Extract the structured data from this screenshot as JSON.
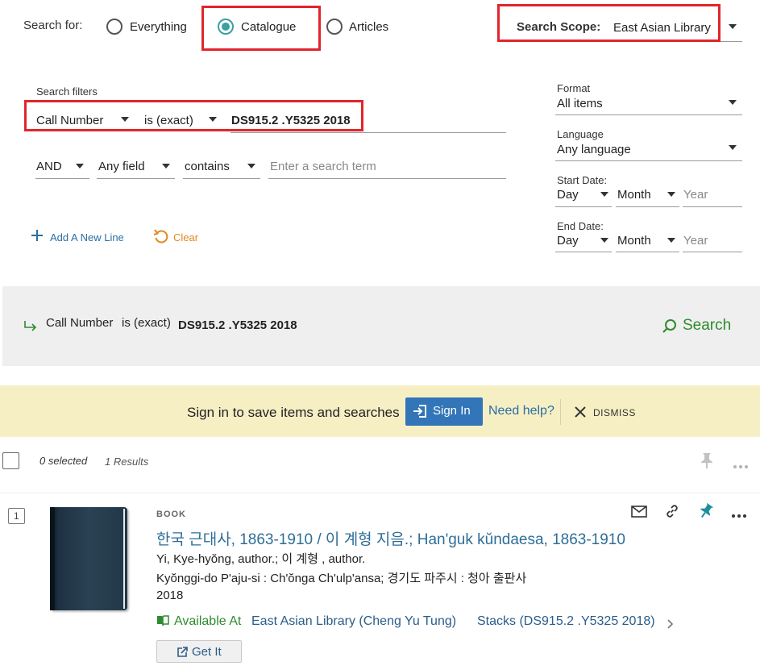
{
  "search_for": {
    "label": "Search for:",
    "options": [
      "Everything",
      "Catalogue",
      "Articles"
    ],
    "selected": "Catalogue"
  },
  "search_scope": {
    "label": "Search Scope:",
    "value": "East Asian Library"
  },
  "filters": {
    "title": "Search filters",
    "row1": {
      "field": "Call Number",
      "operator": "is (exact)",
      "value": "DS915.2 .Y5325 2018"
    },
    "row2": {
      "bool": "AND",
      "field": "Any field",
      "operator": "contains",
      "placeholder": "Enter a search term"
    },
    "add_line": "Add A New Line",
    "clear": "Clear"
  },
  "side_filters": {
    "format": {
      "label": "Format",
      "value": "All items"
    },
    "language": {
      "label": "Language",
      "value": "Any language"
    },
    "start_date": {
      "label": "Start Date:",
      "day": "Day",
      "month": "Month",
      "year_placeholder": "Year"
    },
    "end_date": {
      "label": "End Date:",
      "day": "Day",
      "month": "Month",
      "year_placeholder": "Year"
    }
  },
  "summary": {
    "field": "Call Number",
    "operator": "is (exact)",
    "value": "DS915.2 .Y5325 2018",
    "search_button": "Search"
  },
  "banner": {
    "text": "Sign in to save items and searches",
    "signin": "Sign In",
    "help": "Need help?",
    "dismiss": "DISMISS"
  },
  "results_bar": {
    "selected": "0 selected",
    "count": "1 Results"
  },
  "result": {
    "index": "1",
    "type": "BOOK",
    "title": "한국 근대사, 1863-1910 / 이 계형 지음.; Han'guk kŭndaesa, 1863-1910",
    "author": "Yi, Kye-hyŏng, author.; 이 계형 , author.",
    "publisher": "Kyŏnggi-do P'aju-si : Ch'ŏnga Ch'ulp'ansa; 경기도 파주시 : 청아 출판사",
    "year": "2018",
    "availability_prefix": "Available At",
    "availability_location": "East Asian Library (Cheng Yu Tung)",
    "availability_stacks": "Stacks (DS915.2 .Y5325 2018)",
    "get_it": "Get It"
  },
  "colors": {
    "accent": "#3aa0a0",
    "highlight_box": "#e0262b",
    "link": "#2a6ea3",
    "available_green": "#2e8b2e",
    "signin_blue": "#3275b8",
    "banner_bg": "#f7efc4",
    "search_bar_bg": "#efefef",
    "clear_orange": "#e08a1e",
    "pin_teal": "#1a8fa0"
  }
}
